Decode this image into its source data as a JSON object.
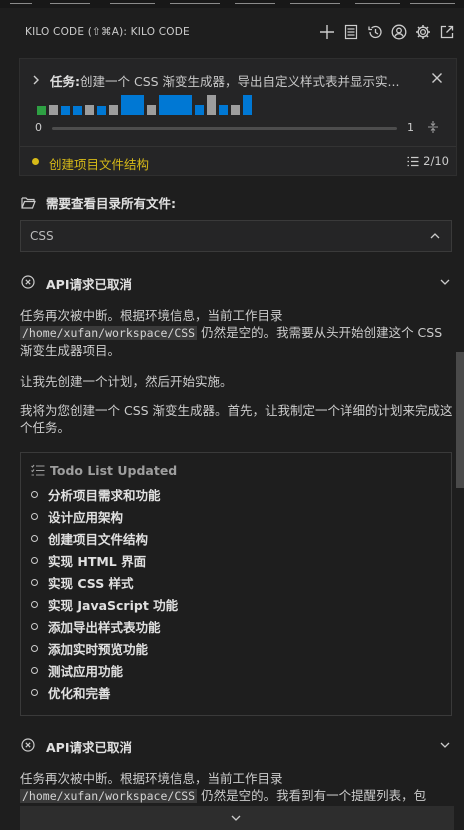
{
  "header": {
    "title": "KILO CODE (⇧⌘A): KILO CODE",
    "icons": [
      "plus-icon",
      "menu-list-icon",
      "history-icon",
      "account-icon",
      "gear-icon",
      "popout-icon"
    ]
  },
  "task": {
    "label": "任务:",
    "text": "创建一个 CSS 渐变生成器，导出自定义样式表并显示实...",
    "slider_min": "0",
    "slider_max": "1",
    "current_step": "创建项目文件结构",
    "step_count": "2/10",
    "bar_colors": [
      "#2ea043",
      "#9d9d9d",
      "#0078d4",
      "#0078d4",
      "#9d9d9d",
      "#0078d4",
      "#9d9d9d",
      "#0078d4",
      "#9d9d9d",
      "#0078d4",
      "#0078d4",
      "#9d9d9d",
      "#0078d4",
      "#9d9d9d",
      "#0078d4"
    ]
  },
  "directory": {
    "label": "需要查看目录所有文件:",
    "value": "CSS"
  },
  "section1": {
    "title": "API请求已取消",
    "p1_before": "任务再次被中断。根据环境信息，当前工作目录",
    "p1_code": "/home/xufan/workspace/CSS",
    "p1_after": "仍然是空的。我需要从头开始创建这个 CSS 渐变生成器项目。",
    "p2": "让我先创建一个计划，然后开始实施。",
    "p3": "我将为您创建一个 CSS 渐变生成器。首先，让我制定一个详细的计划来完成这个任务。"
  },
  "todo": {
    "title": "Todo List Updated",
    "items": [
      "分析项目需求和功能",
      "设计应用架构",
      "创建项目文件结构",
      "实现 HTML 界面",
      "实现 CSS 样式",
      "实现 JavaScript 功能",
      "添加导出样式表功能",
      "添加实时预览功能",
      "测试应用功能",
      "优化和完善"
    ]
  },
  "section2": {
    "title": "API请求已取消",
    "p1_before": "任务再次被中断。根据环境信息，当前工作目录",
    "p1_code": "/home/xufan/workspace/CSS",
    "p1_after": "仍然是空的。我看到有一个提醒列表，包"
  },
  "colors": {
    "accent": "#0078d4",
    "warning": "#d7ba18",
    "success": "#2ea043"
  }
}
